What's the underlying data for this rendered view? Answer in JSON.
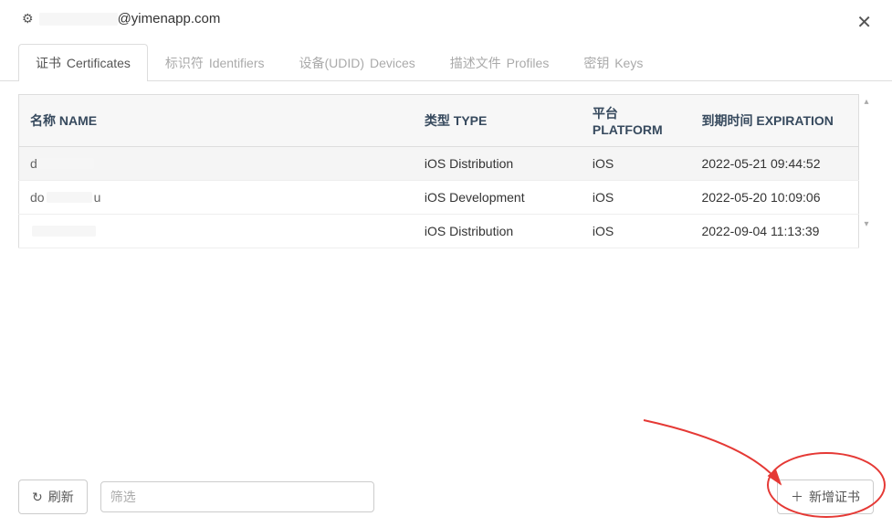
{
  "header": {
    "email_suffix": "@yimenapp.com"
  },
  "tabs": [
    {
      "zh": "证书",
      "en": "Certificates",
      "active": true
    },
    {
      "zh": "标识符",
      "en": "Identifiers",
      "active": false
    },
    {
      "zh": "设备(UDID)",
      "en": "Devices",
      "active": false
    },
    {
      "zh": "描述文件",
      "en": "Profiles",
      "active": false
    },
    {
      "zh": "密钥",
      "en": "Keys",
      "active": false
    }
  ],
  "table": {
    "headers": {
      "name": "名称 NAME",
      "type": "类型 TYPE",
      "platform": "平台 PLATFORM",
      "expiration": "到期时间 EXPIRATION"
    },
    "rows": [
      {
        "name_prefix": "d",
        "name_suffix": "",
        "type": "iOS Distribution",
        "platform": "iOS",
        "expiration": "2022-05-21 09:44:52",
        "selected": true
      },
      {
        "name_prefix": "do",
        "name_suffix": "u",
        "type": "iOS Development",
        "platform": "iOS",
        "expiration": "2022-05-20 10:09:06",
        "selected": false
      },
      {
        "name_prefix": "",
        "name_suffix": "",
        "type": "iOS Distribution",
        "platform": "iOS",
        "expiration": "2022-09-04 11:13:39",
        "selected": false
      }
    ]
  },
  "footer": {
    "refresh_label": "刷新",
    "filter_placeholder": "筛选",
    "add_label": "新增证书"
  },
  "icons": {
    "gear": "⚙",
    "close": "✕",
    "refresh": "↻",
    "plus": "＋",
    "caret_up": "▴",
    "caret_down": "▾"
  }
}
